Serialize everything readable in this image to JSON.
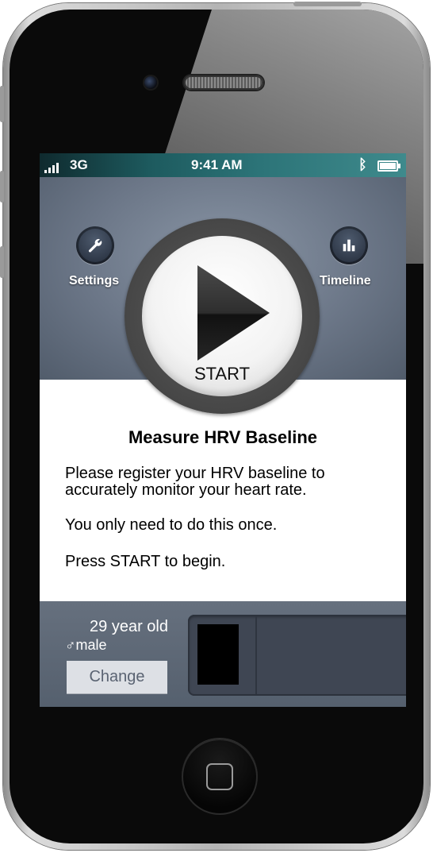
{
  "status_bar": {
    "carrier": "3G",
    "time": "9:41 AM",
    "bluetooth_icon": "bluetooth-icon",
    "battery_icon": "battery-icon"
  },
  "nav": {
    "settings_label": "Settings",
    "settings_icon": "wrench-icon",
    "timeline_label": "Timeline",
    "timeline_icon": "bar-chart-icon"
  },
  "start_button": {
    "label": "START",
    "icon": "play-icon"
  },
  "info": {
    "title": "Measure HRV Baseline",
    "paragraph1": "Please register your HRV baseline to accurately monitor your heart rate.",
    "paragraph2": "You only need to do this once.",
    "paragraph3": "Press START to begin."
  },
  "profile": {
    "age": "29 year old",
    "gender_symbol": "♂",
    "gender": "male",
    "change_label": "Change"
  },
  "colors": {
    "content_bg": "#ffffff",
    "bottom_bar": "#5d6878",
    "status_bar": "#1d5a5e"
  }
}
